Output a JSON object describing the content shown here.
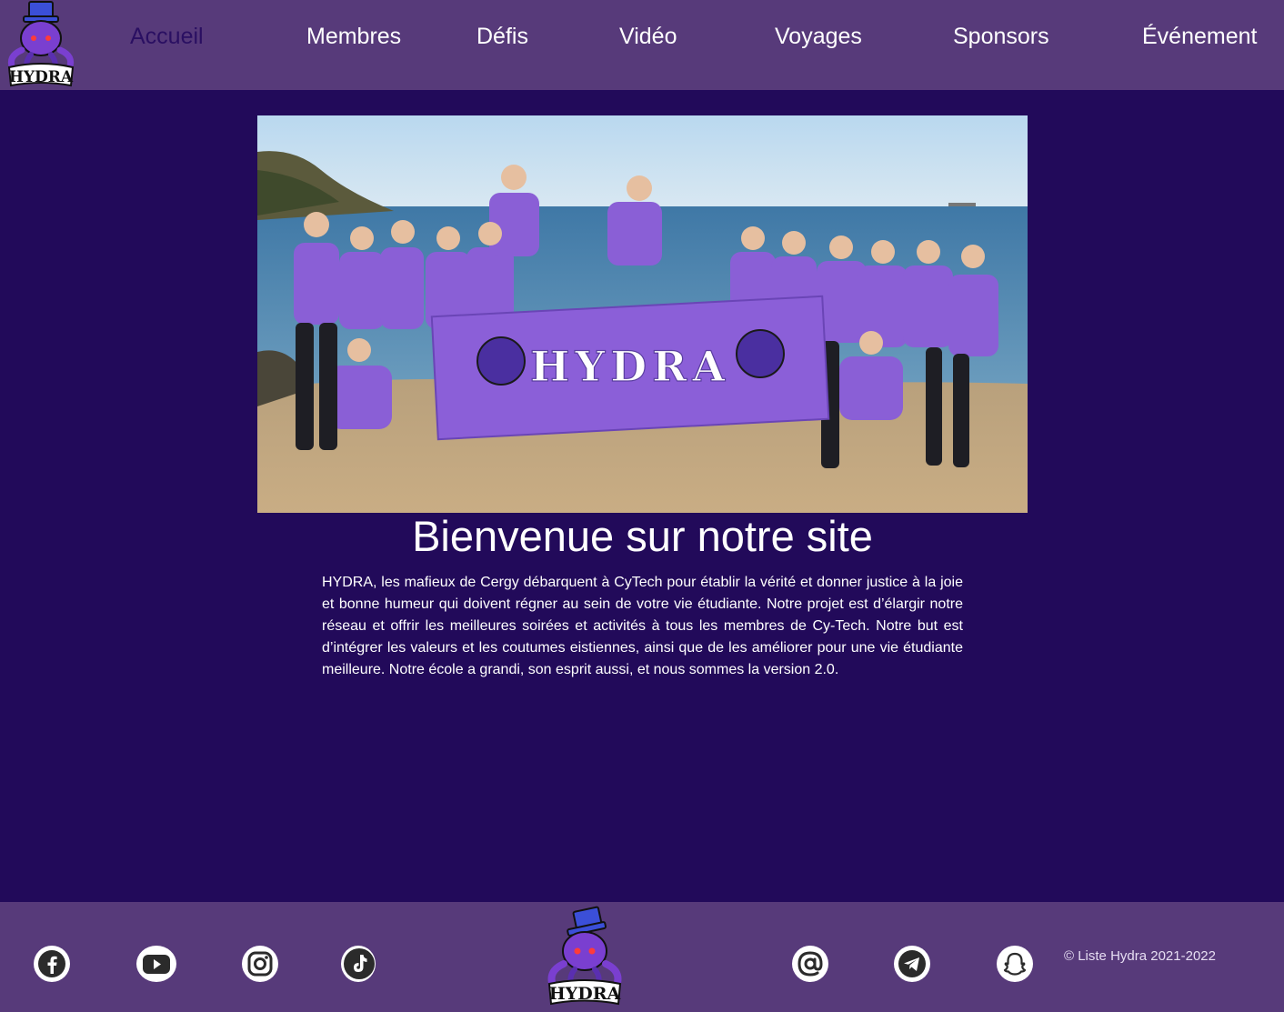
{
  "header": {
    "logo_text": "HYDRA",
    "nav": [
      {
        "label": "Accueil",
        "active": true
      },
      {
        "label": "Membres"
      },
      {
        "label": "Défis"
      },
      {
        "label": "Vidéo"
      },
      {
        "label": "Voyages"
      },
      {
        "label": "Sponsors"
      },
      {
        "label": "Événement"
      }
    ]
  },
  "main": {
    "banner_text": "HYDRA",
    "title": "Bienvenue sur notre site",
    "intro": "HYDRA, les mafieux de Cergy débarquent à CyTech pour établir la vérité et donner justice à la joie et bonne humeur qui doivent régner au sein de votre vie étudiante. Notre projet est d’élargir notre réseau et offrir les meilleures soirées et activités à tous les membres de Cy-Tech. Notre but est d’intégrer les valeurs et les coutumes eistiennes, ainsi que de les améliorer pour une vie étudiante meilleure. Notre école a grandi, son esprit aussi, et nous sommes la version 2.0."
  },
  "footer": {
    "socials": [
      "facebook-icon",
      "youtube-icon",
      "instagram-icon",
      "tiktok-icon"
    ],
    "contacts": [
      "at-sign-icon",
      "telegram-icon",
      "snapchat-icon"
    ],
    "logo_text": "HYDRA",
    "copyright": "© Liste Hydra 2021-2022"
  },
  "colors": {
    "header_bg": "#573a7a",
    "page_bg": "#220a5a",
    "active_nav": "#2a0f62",
    "shirt_purple": "#8a5fd6"
  }
}
